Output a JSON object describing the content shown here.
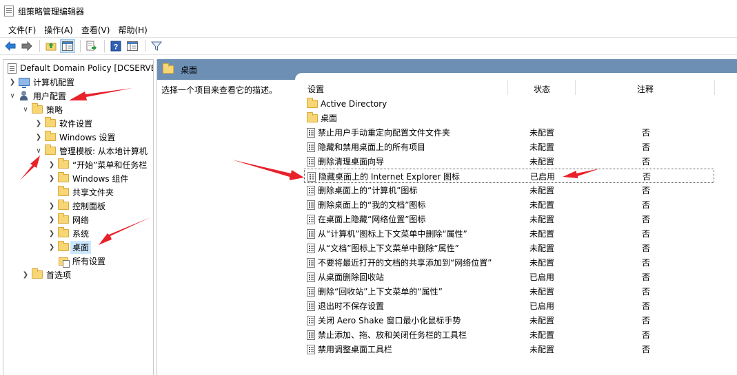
{
  "window": {
    "title": "组策略管理编辑器"
  },
  "menu": [
    "文件(F)",
    "操作(A)",
    "查看(V)",
    "帮助(H)"
  ],
  "toolbar": {
    "buttons": [
      "back-icon",
      "forward-icon",
      "up-folder-icon",
      "show-hide-tree-icon",
      "export-list-icon",
      "help-icon",
      "extended-view-icon",
      "filter-icon"
    ]
  },
  "tree": {
    "root": "Default Domain Policy [DCSERVE",
    "computer_config": "计算机配置",
    "user_config": "用户配置",
    "policies": "策略",
    "software_settings": "软件设置",
    "windows_settings": "Windows 设置",
    "admin_templates": "管理模板: 从本地计算机",
    "start_menu": "“开始”菜单和任务栏",
    "windows_components": "Windows 组件",
    "shared_folders": "共享文件夹",
    "control_panel": "控制面板",
    "network": "网络",
    "system": "系统",
    "desktop": "桌面",
    "all_settings": "所有设置",
    "preferences": "首选项"
  },
  "detail": {
    "header": "桌面",
    "description": "选择一个项目来查看它的描述。",
    "columns": {
      "setting": "设置",
      "state": "状态",
      "comment": "注释"
    },
    "folders": [
      "Active Directory",
      "桌面"
    ],
    "rows": [
      {
        "name": "禁止用户手动重定向配置文件文件夹",
        "state": "未配置",
        "comment": "否"
      },
      {
        "name": "隐藏和禁用桌面上的所有项目",
        "state": "未配置",
        "comment": "否"
      },
      {
        "name": "删除清理桌面向导",
        "state": "未配置",
        "comment": "否"
      },
      {
        "name": "隐藏桌面上的 Internet Explorer 图标",
        "state": "已启用",
        "comment": "否"
      },
      {
        "name": "删除桌面上的“计算机”图标",
        "state": "未配置",
        "comment": "否"
      },
      {
        "name": "删除桌面上的“我的文档”图标",
        "state": "未配置",
        "comment": "否"
      },
      {
        "name": "在桌面上隐藏“网络位置”图标",
        "state": "未配置",
        "comment": "否"
      },
      {
        "name": "从“计算机”图标上下文菜单中删除“属性”",
        "state": "未配置",
        "comment": "否"
      },
      {
        "name": "从“文档”图标上下文菜单中删除“属性”",
        "state": "未配置",
        "comment": "否"
      },
      {
        "name": "不要将最近打开的文档的共享添加到“网络位置”",
        "state": "未配置",
        "comment": "否"
      },
      {
        "name": "从桌面删除回收站",
        "state": "已启用",
        "comment": "否"
      },
      {
        "name": "删除“回收站”上下文菜单的“属性”",
        "state": "未配置",
        "comment": "否"
      },
      {
        "name": "退出时不保存设置",
        "state": "已启用",
        "comment": "否"
      },
      {
        "name": "关闭 Aero Shake 窗口最小化鼠标手势",
        "state": "未配置",
        "comment": "否"
      },
      {
        "name": "禁止添加、拖、放和关闭任务栏的工具栏",
        "state": "未配置",
        "comment": "否"
      },
      {
        "name": "禁用调整桌面工具栏",
        "state": "未配置",
        "comment": "否"
      }
    ]
  },
  "colors": {
    "header_band": "#6d8fb3",
    "selection": "#cce8ff",
    "annotation_arrow": "#e8212b"
  }
}
